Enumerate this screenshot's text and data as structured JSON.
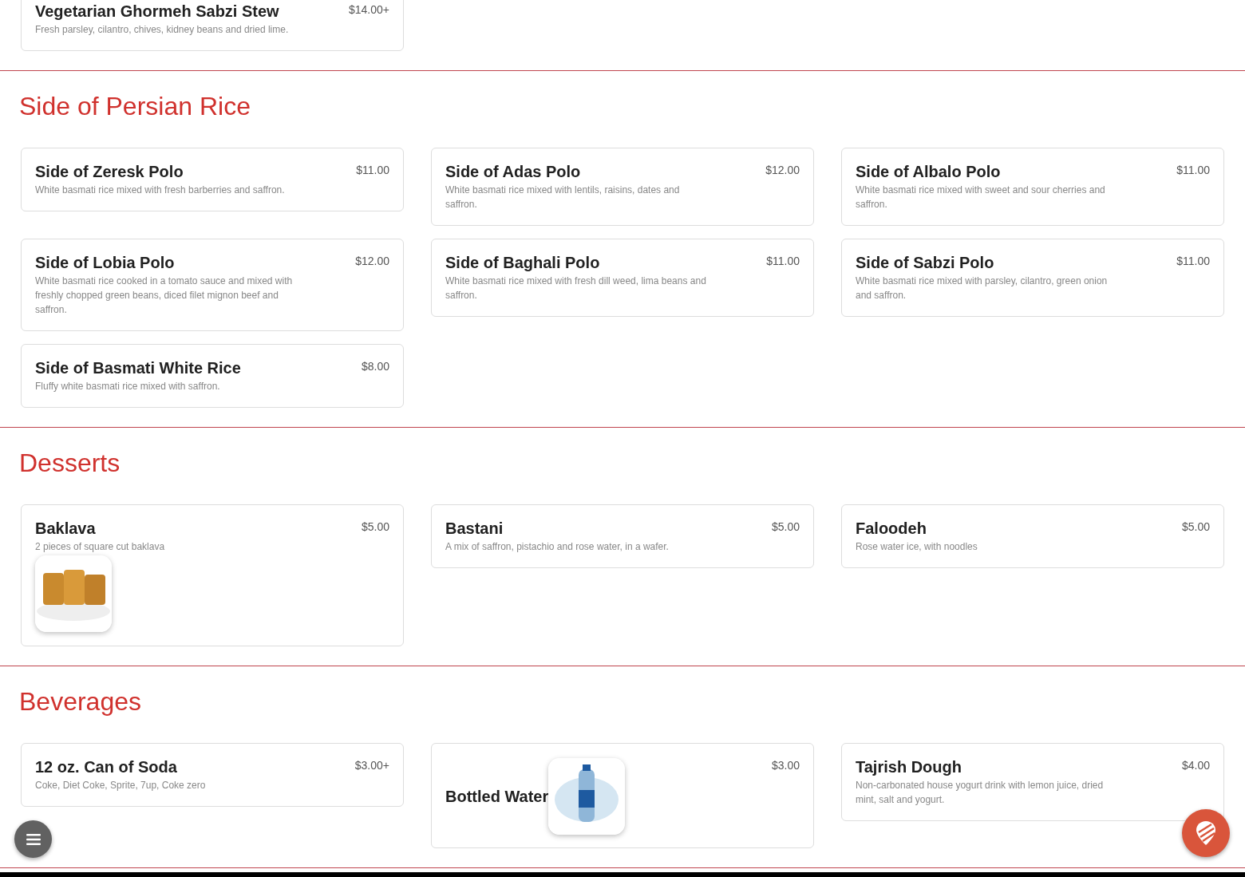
{
  "sections": [
    {
      "items": [
        {
          "kind": "plain",
          "name": "Vegetarian Ghormeh Sabzi Stew",
          "price": "$14.00+",
          "description": "Fresh parsley, cilantro, chives, kidney beans and dried lime."
        }
      ]
    },
    {
      "title": "Side of Persian Rice",
      "items": [
        {
          "kind": "plain",
          "name": "Side of Zeresk Polo",
          "price": "$11.00",
          "description": "White basmati rice mixed with fresh barberries and saffron."
        },
        {
          "kind": "plain",
          "name": "Side of Adas Polo",
          "price": "$12.00",
          "description": "White basmati rice mixed with lentils, raisins, dates and saffron."
        },
        {
          "kind": "plain",
          "name": "Side of Albalo Polo",
          "price": "$11.00",
          "description": "White basmati rice mixed with sweet and sour cherries and saffron."
        },
        {
          "kind": "plain",
          "name": "Side of Lobia Polo",
          "price": "$12.00",
          "description": "White basmati rice cooked in a tomato sauce and mixed with freshly chopped green beans, diced filet mignon beef and saffron."
        },
        {
          "kind": "plain",
          "name": "Side of Baghali Polo",
          "price": "$11.00",
          "description": "White basmati rice mixed with fresh dill weed, lima beans and saffron."
        },
        {
          "kind": "plain",
          "name": "Side of Sabzi Polo",
          "price": "$11.00",
          "description": "White basmati rice mixed with parsley, cilantro, green onion and saffron."
        },
        {
          "kind": "plain",
          "name": "Side of Basmati White Rice",
          "price": "$8.00",
          "description": "Fluffy white basmati rice mixed with saffron."
        }
      ]
    },
    {
      "title": "Desserts",
      "items": [
        {
          "kind": "photo-below",
          "name": "Baklava",
          "price": "$5.00",
          "description": "2 pieces of square cut baklava"
        },
        {
          "kind": "plain",
          "name": "Bastani",
          "price": "$5.00",
          "description": "A mix of saffron, pistachio and rose water, in a wafer."
        },
        {
          "kind": "plain",
          "name": "Faloodeh",
          "price": "$5.00",
          "description": "Rose water ice, with noodles"
        }
      ]
    },
    {
      "title": "Beverages",
      "items": [
        {
          "kind": "plain",
          "name": "12 oz. Can of Soda",
          "price": "$3.00+",
          "description": "Coke, Diet Coke, Sprite, 7up, Coke zero"
        },
        {
          "kind": "photo-beside",
          "name": "Bottled Water",
          "price": "$3.00"
        },
        {
          "kind": "plain",
          "name": "Tajrish Dough",
          "price": "$4.00",
          "description": "Non-carbonated house yogurt drink with lemon juice, dried mint, salt and yogurt."
        }
      ]
    }
  ]
}
